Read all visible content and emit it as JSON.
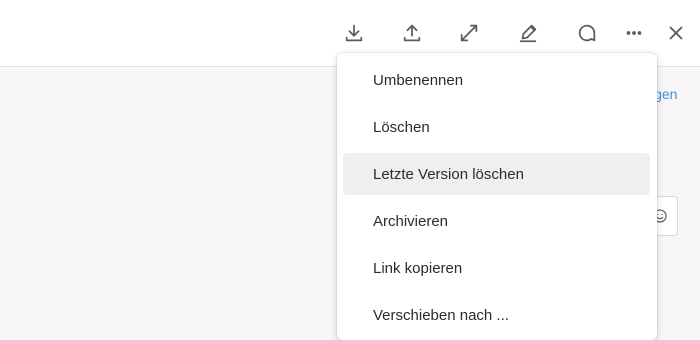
{
  "toolbar": {
    "icons": [
      "download-icon",
      "upload-icon",
      "expand-icon",
      "edit-icon",
      "comment-icon",
      "more-icon",
      "close-icon"
    ]
  },
  "background": {
    "right_link": "igen"
  },
  "menu": {
    "items": [
      {
        "label": "Umbenennen",
        "active": false
      },
      {
        "label": "Löschen",
        "active": false
      },
      {
        "label": "Letzte Version löschen",
        "active": true
      },
      {
        "label": "Archivieren",
        "active": false
      },
      {
        "label": "Link kopieren",
        "active": false
      },
      {
        "label": "Verschieben nach ...",
        "active": false
      }
    ]
  },
  "colors": {
    "accent": "#4b8fd6",
    "menu_hover": "#efefef",
    "icon": "#5b5b5f"
  }
}
